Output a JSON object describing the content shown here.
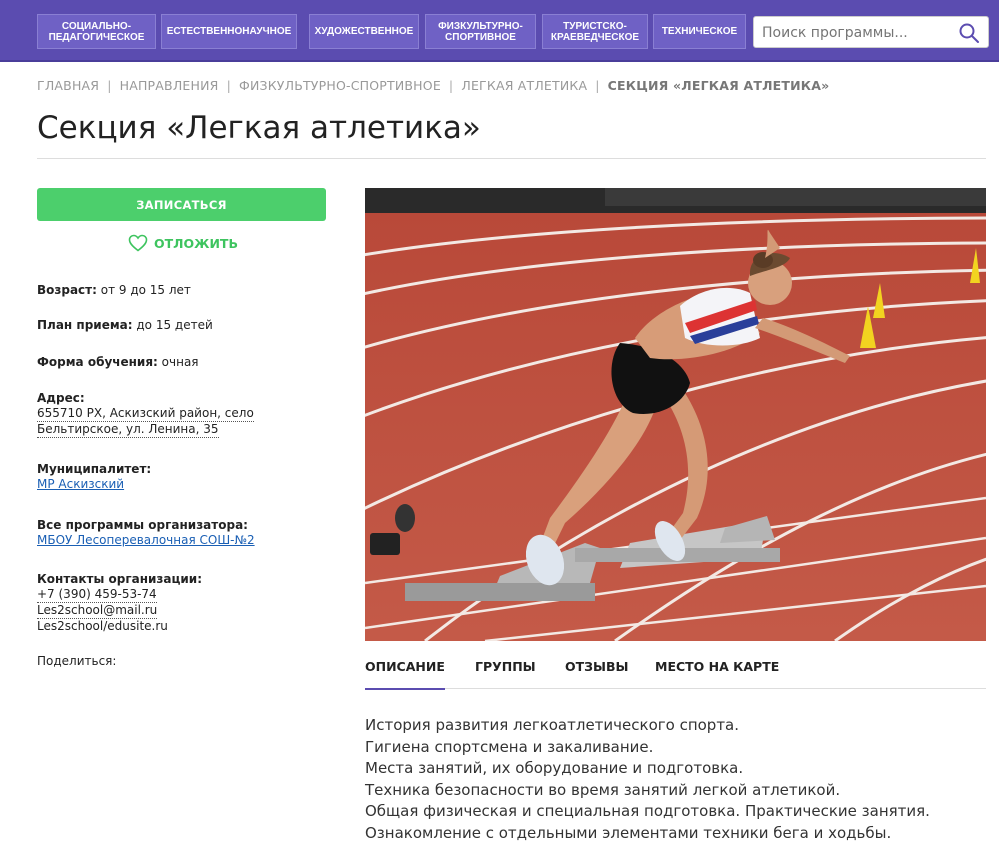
{
  "nav": {
    "items": [
      {
        "label_line1": "СОЦИАЛЬНО-",
        "label_line2": "ПЕДАГОГИЧЕСКОЕ"
      },
      {
        "label_line1": "ЕСТЕСТВЕННОНАУЧНОЕ",
        "label_line2": ""
      },
      {
        "label_line1": "ХУДОЖЕСТВЕННОЕ",
        "label_line2": ""
      },
      {
        "label_line1": "ФИЗКУЛЬТУРНО-",
        "label_line2": "СПОРТИВНОЕ"
      },
      {
        "label_line1": "ТУРИСТСКО-",
        "label_line2": "КРАЕВЕДЧЕСКОЕ"
      },
      {
        "label_line1": "ТЕХНИЧЕСКОЕ",
        "label_line2": ""
      }
    ],
    "search_placeholder": "Поиск программы...",
    "search_icon": "search-icon",
    "color": "#5b4cb0"
  },
  "breadcrumb": {
    "items": [
      "ГЛАВНАЯ",
      "НАПРАВЛЕНИЯ",
      "ФИЗКУЛЬТУРНО-СПОРТИВНОЕ",
      "ЛЕГКАЯ АТЛЕТИКА"
    ],
    "current": "СЕКЦИЯ «ЛЕГКАЯ АТЛЕТИКА»"
  },
  "page": {
    "title": "Секция «Легкая атлетика»"
  },
  "sidebar": {
    "enroll_label": "ЗАПИСАТЬСЯ",
    "postpone_label": "ОТЛОЖИТЬ",
    "postpone_icon": "heart-icon",
    "age_label": "Возраст:",
    "age_value": "от 9 до 15 лет",
    "plan_label": "План приема:",
    "plan_value": "до 15 детей",
    "form_label": "Форма обучения:",
    "form_value": "очная",
    "address_label": "Адрес:",
    "address_line1": "655710 РХ, Аскизский район, село",
    "address_line2": "Бельтирское, ул. Ленина, 35",
    "municipality_label": "Муниципалитет:",
    "municipality_value": "МР Аскизский",
    "organizer_label": "Все программы организатора:",
    "organizer_value": "МБОУ Лесоперевалочная СОШ-№2",
    "contacts_label": "Контакты организации:",
    "phone": "+7 (390) 459-53-74",
    "email": "Les2school@mail.ru",
    "site": "Les2school/edusite.ru",
    "share_label": "Поделиться:",
    "accent": "#4ccf6c"
  },
  "tabs": [
    "ОПИСАНИЕ",
    "ГРУППЫ",
    "ОТЗЫВЫ",
    "МЕСТО НА КАРТЕ"
  ],
  "description": [
    "История развития легкоатлетического спорта.",
    "Гигиена спортсмена и закаливание.",
    "Места занятий, их оборудование и подготовка.",
    "Техника безопасности во время занятий легкой атлетикой.",
    "Общая физическая и специальная подготовка. Практические занятия.",
    "Ознакомление с отдельными элементами техники бега и ходьбы."
  ]
}
